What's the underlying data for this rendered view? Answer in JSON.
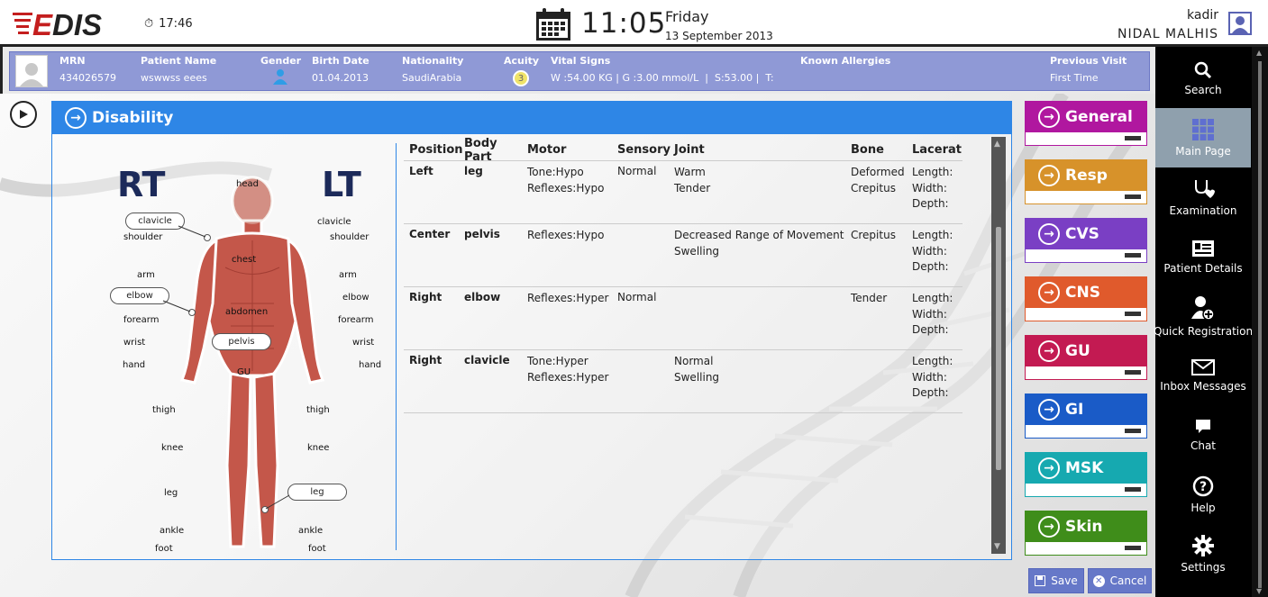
{
  "header": {
    "logo": "EDIS",
    "timer": "17:46",
    "clock": "11:05",
    "day": "Friday",
    "date": "13 September 2013",
    "username": "kadir",
    "fullname": "NIDAL  MALHIS"
  },
  "patient": {
    "mrn_label": "MRN",
    "mrn": "434026579",
    "name_label": "Patient Name",
    "name": "wswwss eees",
    "gender_label": "Gender",
    "birth_label": "Birth Date",
    "birth": "01.04.2013",
    "nat_label": "Nationality",
    "nat": "SaudiArabia",
    "acuity_label": "Acuity",
    "acuity": "3",
    "vitals_label": "Vital Signs",
    "vitals": "W :54.00 KG | G :3.00 mmol/L  |  S:53.00 |  T:",
    "allergies_label": "Known Allergies",
    "prev_label": "Previous Visit",
    "prev": "First Time"
  },
  "panel": {
    "title": "Disability"
  },
  "body_map": {
    "rt": "RT",
    "lt": "LT",
    "labels": {
      "head": "head",
      "clavicle": "clavicle",
      "shoulder": "shoulder",
      "chest": "chest",
      "arm": "arm",
      "elbow": "elbow",
      "forearm": "forearm",
      "abdomen": "abdomen",
      "wrist": "wrist",
      "pelvis": "pelvis",
      "hand": "hand",
      "gu": "GU",
      "thigh": "thigh",
      "knee": "knee",
      "leg": "leg",
      "ankle": "ankle",
      "foot": "foot"
    }
  },
  "table": {
    "headers": {
      "position": "Position",
      "body_part": "Body Part",
      "motor": "Motor",
      "sensory": "Sensory",
      "joint": "Joint",
      "bone": "Bone",
      "lacerat": "Lacerat"
    },
    "rows": [
      {
        "position": "Left",
        "body_part": "leg",
        "motor1": "Tone:Hypo",
        "motor2": "Reflexes:Hypo",
        "sensory": "Normal",
        "joint1": "Warm",
        "joint2": "Tender",
        "bone1": "Deformed",
        "bone2": "Crepitus",
        "len": "Length:",
        "wid": "Width:",
        "dep": "Depth:"
      },
      {
        "position": "Center",
        "body_part": "pelvis",
        "motor1": "Reflexes:Hypo",
        "motor2": "",
        "sensory": "",
        "joint1": "Decreased Range of Movement",
        "joint2": "Swelling",
        "bone1": "Crepitus",
        "bone2": "",
        "len": "Length:",
        "wid": "Width:",
        "dep": "Depth:"
      },
      {
        "position": "Right",
        "body_part": "elbow",
        "motor1": "Reflexes:Hyper",
        "motor2": "",
        "sensory": "Normal",
        "joint1": "",
        "joint2": "",
        "bone1": "Tender",
        "bone2": "",
        "len": "Length:",
        "wid": "Width:",
        "dep": "Depth:"
      },
      {
        "position": "Right",
        "body_part": "clavicle",
        "motor1": "Tone:Hyper",
        "motor2": "Reflexes:Hyper",
        "sensory": "",
        "joint1": "Normal",
        "joint2": "Swelling",
        "bone1": "",
        "bone2": "",
        "len": "Length:",
        "wid": "Width:",
        "dep": "Depth:"
      }
    ]
  },
  "categories": [
    {
      "label": "General",
      "color": "#b0179f"
    },
    {
      "label": "Resp",
      "color": "#d7922a"
    },
    {
      "label": "CVS",
      "color": "#7a3fc4"
    },
    {
      "label": "CNS",
      "color": "#e05a2c"
    },
    {
      "label": "GU",
      "color": "#c31a52"
    },
    {
      "label": "GI",
      "color": "#1a5bc7"
    },
    {
      "label": "MSK",
      "color": "#16a9b0"
    },
    {
      "label": "Skin",
      "color": "#3f8d1a"
    }
  ],
  "sidebar": [
    {
      "label": "Search",
      "icon": "search-icon"
    },
    {
      "label": "Main Page",
      "icon": "grid-icon"
    },
    {
      "label": "Examination",
      "icon": "stethoscope-icon"
    },
    {
      "label": "Patient Details",
      "icon": "id-card-icon"
    },
    {
      "label": "Quick Registration",
      "icon": "add-user-icon"
    },
    {
      "label": "Inbox Messages",
      "icon": "envelope-icon"
    },
    {
      "label": "Chat",
      "icon": "chat-icon"
    },
    {
      "label": "Help",
      "icon": "help-icon"
    },
    {
      "label": "Settings",
      "icon": "gear-icon"
    }
  ],
  "buttons": {
    "save": "Save",
    "cancel": "Cancel"
  }
}
